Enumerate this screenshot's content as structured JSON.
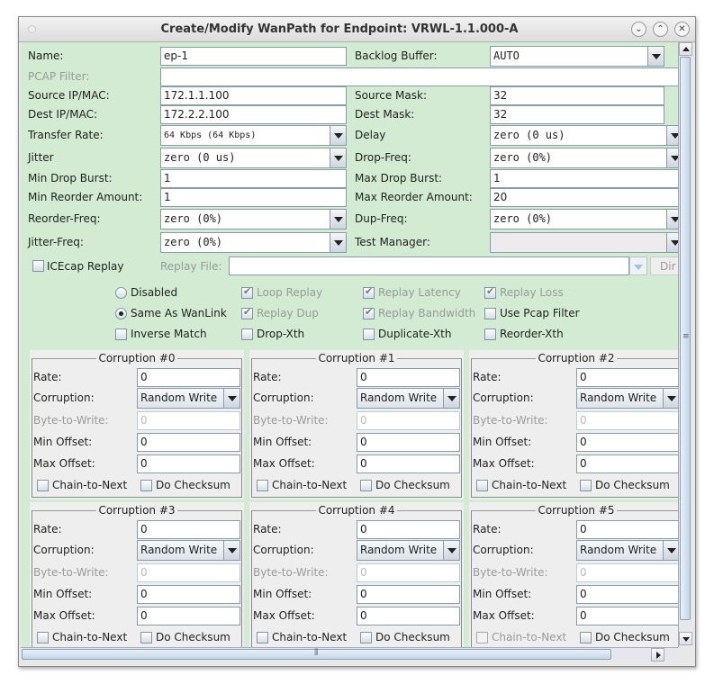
{
  "window": {
    "title": "Create/Modify WanPath for Endpoint: VRWL-1.1.000-A",
    "buttons": [
      "minimize",
      "maximize",
      "close"
    ]
  },
  "form": {
    "rows": [
      {
        "left": {
          "label": "Name:",
          "value": "ep-1",
          "kind": "text"
        },
        "right": {
          "label": "Backlog Buffer:",
          "value": "AUTO",
          "kind": "select"
        }
      },
      {
        "left": {
          "label": "PCAP Filter:",
          "value": "",
          "kind": "wide",
          "disabled": true
        }
      },
      {
        "left": {
          "label": "Source IP/MAC:",
          "value": "172.1.1.100",
          "kind": "text"
        },
        "right": {
          "label": "Source Mask:",
          "value": "32",
          "kind": "text"
        }
      },
      {
        "left": {
          "label": "Dest IP/MAC:",
          "value": "172.2.2.100",
          "kind": "text"
        },
        "right": {
          "label": "Dest Mask:",
          "value": "32",
          "kind": "text"
        }
      },
      {
        "left": {
          "label": "Transfer Rate:",
          "value": "64 Kbps (64 Kbps)",
          "kind": "select"
        },
        "right": {
          "label": "Delay",
          "value": "zero (0 us)",
          "kind": "select"
        }
      },
      {
        "left": {
          "label": "Jitter",
          "value": "zero (0 us)",
          "kind": "select"
        },
        "right": {
          "label": "Drop-Freq:",
          "value": "zero (0%)",
          "kind": "select"
        }
      },
      {
        "left": {
          "label": "Min Drop Burst:",
          "value": "1",
          "kind": "text"
        },
        "right": {
          "label": "Max Drop Burst:",
          "value": "1",
          "kind": "text"
        }
      },
      {
        "left": {
          "label": "Min Reorder Amount:",
          "value": "1",
          "kind": "text"
        },
        "right": {
          "label": "Max Reorder Amount:",
          "value": "20",
          "kind": "text"
        }
      },
      {
        "left": {
          "label": "Reorder-Freq:",
          "value": "zero (0%)",
          "kind": "select"
        },
        "right": {
          "label": "Dup-Freq:",
          "value": "zero (0%)",
          "kind": "select"
        }
      },
      {
        "left": {
          "label": "Jitter-Freq:",
          "value": "zero (0%)",
          "kind": "select"
        },
        "right": {
          "label": "Test Manager:",
          "value": "",
          "kind": "select",
          "disabled": true
        }
      }
    ],
    "icecap": {
      "label": "ICEcap Replay",
      "checked": false,
      "replay_file_label": "Replay File:",
      "replay_file_value": "",
      "dir_button": "Dir"
    },
    "options": [
      [
        {
          "type": "radio",
          "label": "Disabled",
          "checked": false
        },
        {
          "type": "check",
          "label": "Loop Replay",
          "checked": true,
          "disabled": true
        },
        {
          "type": "check",
          "label": "Replay Latency",
          "checked": true,
          "disabled": true
        },
        {
          "type": "check",
          "label": "Replay Loss",
          "checked": true,
          "disabled": true
        }
      ],
      [
        {
          "type": "radio",
          "label": "Same As WanLink",
          "checked": true
        },
        {
          "type": "check",
          "label": "Replay Dup",
          "checked": true,
          "disabled": true
        },
        {
          "type": "check",
          "label": "Replay Bandwidth",
          "checked": true,
          "disabled": true
        },
        {
          "type": "check",
          "label": "Use Pcap Filter",
          "checked": false
        }
      ],
      [
        {
          "type": "check",
          "label": "Inverse Match",
          "checked": false
        },
        {
          "type": "check",
          "label": "Drop-Xth",
          "checked": false
        },
        {
          "type": "check",
          "label": "Duplicate-Xth",
          "checked": false
        },
        {
          "type": "check",
          "label": "Reorder-Xth",
          "checked": false
        }
      ]
    ]
  },
  "corruption_labels": {
    "rate": "Rate:",
    "corruption": "Corruption:",
    "byte": "Byte-to-Write:",
    "min": "Min Offset:",
    "max": "Max Offset:",
    "chain": "Chain-to-Next",
    "checksum": "Do Checksum"
  },
  "corruptions": [
    {
      "title": "Corruption #0",
      "rate": "0",
      "type": "Random Write",
      "byte": "0",
      "min": "0",
      "max": "0",
      "chain": false,
      "checksum": false
    },
    {
      "title": "Corruption #1",
      "rate": "0",
      "type": "Random Write",
      "byte": "0",
      "min": "0",
      "max": "0",
      "chain": false,
      "checksum": false
    },
    {
      "title": "Corruption #2",
      "rate": "0",
      "type": "Random Write",
      "byte": "0",
      "min": "0",
      "max": "0",
      "chain": false,
      "checksum": false
    },
    {
      "title": "Corruption #3",
      "rate": "0",
      "type": "Random Write",
      "byte": "0",
      "min": "0",
      "max": "0",
      "chain": false,
      "checksum": false
    },
    {
      "title": "Corruption #4",
      "rate": "0",
      "type": "Random Write",
      "byte": "0",
      "min": "0",
      "max": "0",
      "chain": false,
      "checksum": false
    },
    {
      "title": "Corruption #5",
      "rate": "0",
      "type": "Random Write",
      "byte": "0",
      "min": "0",
      "max": "0",
      "chain": false,
      "chain_disabled": true,
      "checksum": false
    }
  ],
  "colors": {
    "form_bg": "#d3ebd3",
    "panel_bg": "#eeeeee"
  }
}
